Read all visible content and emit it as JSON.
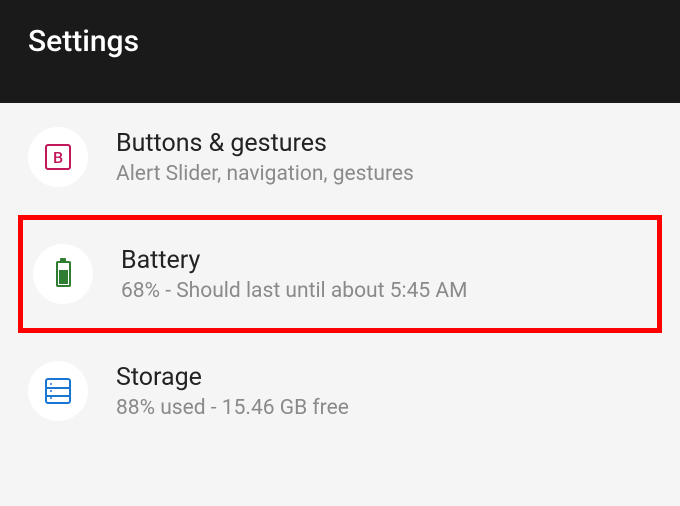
{
  "header": {
    "title": "Settings"
  },
  "items": [
    {
      "title": "Buttons & gestures",
      "subtitle": "Alert Slider, navigation, gestures"
    },
    {
      "title": "Battery",
      "subtitle": "68% - Should last until about 5:45 AM"
    },
    {
      "title": "Storage",
      "subtitle": "88% used - 15.46 GB free"
    }
  ]
}
